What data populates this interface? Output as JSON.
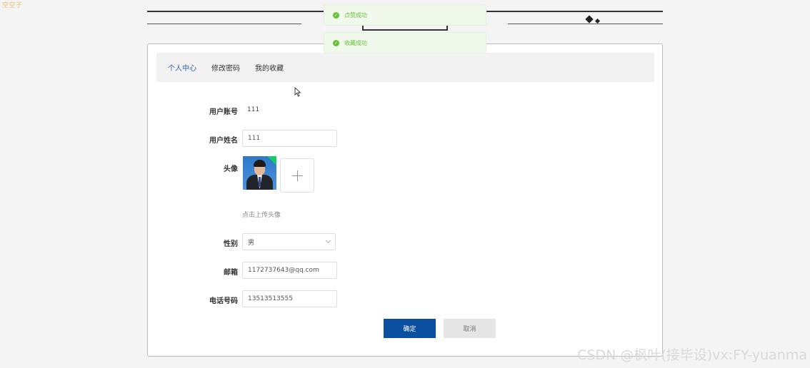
{
  "corner_text": "空空子",
  "toasts": [
    {
      "message": "点赞成功"
    },
    {
      "message": "收藏成功"
    }
  ],
  "tabs": [
    {
      "label": "个人中心",
      "active": true
    },
    {
      "label": "修改密码",
      "active": false
    },
    {
      "label": "我的收藏",
      "active": false
    }
  ],
  "form": {
    "account": {
      "label": "用户账号",
      "value": "111"
    },
    "name": {
      "label": "用户姓名",
      "value": "111"
    },
    "avatar": {
      "label": "头像",
      "upload_hint": "点击上传头像"
    },
    "gender": {
      "label": "性别",
      "value": "男"
    },
    "email": {
      "label": "邮箱",
      "value": "1172737643@qq.com"
    },
    "phone": {
      "label": "电话号码",
      "value": "13513513555"
    }
  },
  "buttons": {
    "confirm": "确定",
    "cancel": "取消"
  },
  "watermark": "CSDN @枫叶(接毕设)vx:FY-yuanma",
  "colors": {
    "primary": "#0b4fa0",
    "active_tab": "#2e62a8",
    "success": "#67c23a"
  }
}
